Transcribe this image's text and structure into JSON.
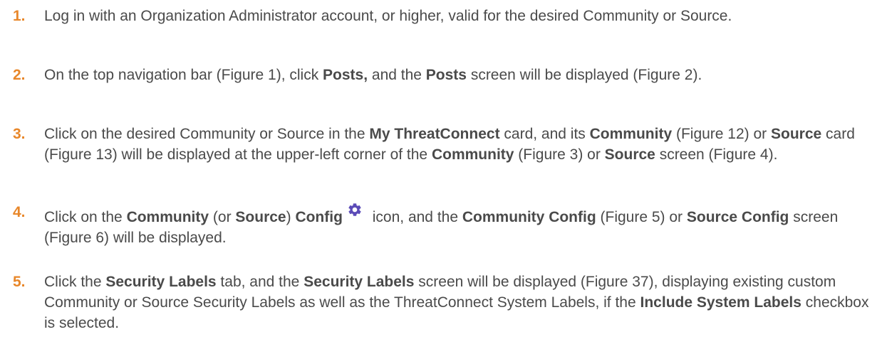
{
  "accent_color": "#e8872a",
  "text_color": "#4a4a4a",
  "icons": {
    "config": "gear-icon"
  },
  "steps": [
    {
      "number": "1.",
      "parts": [
        "Log in with an Organization Administrator account, or higher, valid for the desired Community or Source."
      ]
    },
    {
      "number": "2.",
      "parts": [
        "On the top navigation bar (Figure 1), click ",
        "Posts,",
        " and the ",
        "Posts",
        " screen will be displayed (Figure 2)."
      ]
    },
    {
      "number": "3.",
      "parts": [
        "Click on the desired Community or Source in the ",
        "My ThreatConnect",
        " card, and its ",
        "Community",
        " (Figure 12) or ",
        "Source",
        " card (Figure 13) will be displayed at the upper-left corner of the ",
        "Community",
        " (Figure 3) or ",
        "Source",
        " screen (Figure 4)."
      ]
    },
    {
      "number": "4.",
      "parts": [
        "Click on the ",
        "Community",
        " (or ",
        "Source",
        ") ",
        "Config",
        " icon, and the ",
        "Community Config",
        " (Figure 5) or ",
        "Source Config",
        " screen (Figure 6) will be displayed."
      ]
    },
    {
      "number": "5.",
      "parts": [
        "Click the ",
        "Security Labels",
        " tab, and the ",
        "Security Labels",
        " screen will be displayed (Figure 37), displaying existing custom Community or Source Security Labels as well as the ThreatConnect System Labels, if the ",
        "Include System Labels",
        " checkbox is selected."
      ]
    }
  ]
}
